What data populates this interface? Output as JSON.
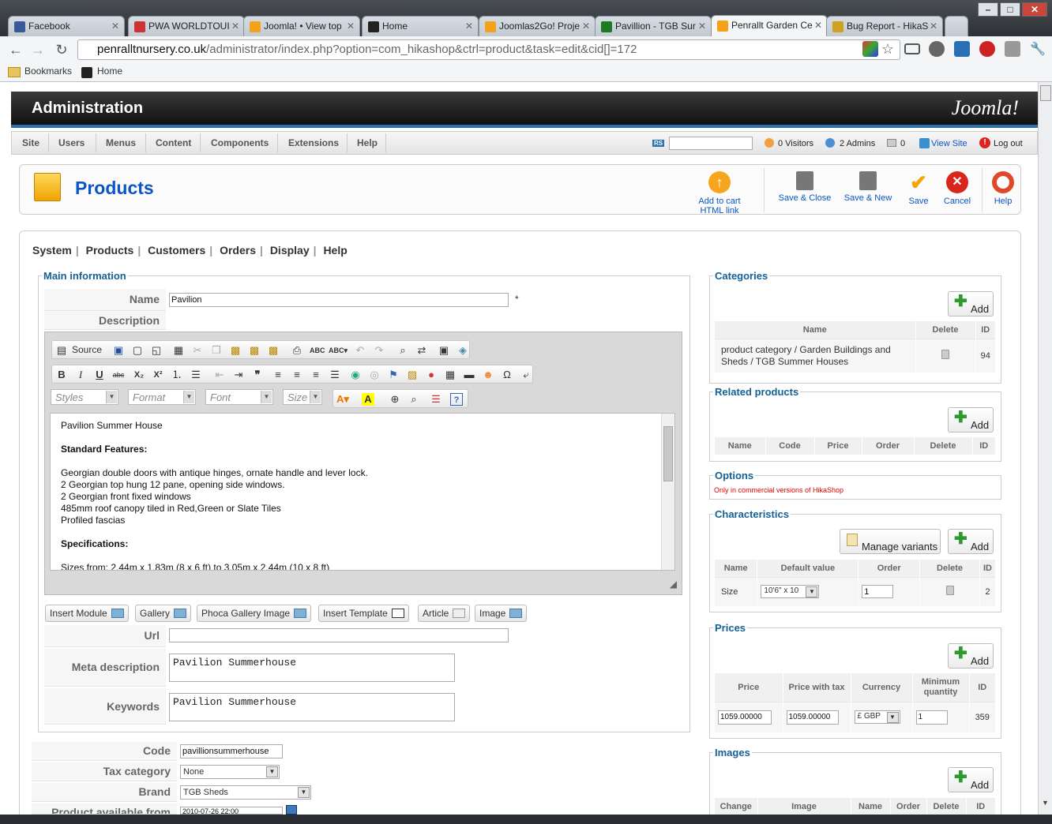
{
  "browser": {
    "tabs": [
      {
        "label": "Facebook",
        "color": "#3b5998"
      },
      {
        "label": "PWA WORLDTOUI",
        "color": "#cc3333"
      },
      {
        "label": "Joomla! • View top",
        "color": "#f4a21c"
      },
      {
        "label": "Home",
        "color": "#222222"
      },
      {
        "label": "Joomlas2Go! Proje",
        "color": "#f4a21c"
      },
      {
        "label": "Pavillion - TGB Sur",
        "color": "#1f7a1f"
      },
      {
        "label": "Penrallt Garden Ce",
        "color": "#f4a21c"
      },
      {
        "label": "Bug Report - HikaS",
        "color": "#d0a020"
      }
    ],
    "url_host": "penralltnursery.co.uk",
    "url_path": "/administrator/index.php?option=com_hikashop&ctrl=product&task=edit&cid[]=172",
    "bookmarks_label": "Bookmarks",
    "home_bookmark": "Home"
  },
  "admin": {
    "title": "Administration",
    "logo": "Joomla!",
    "menu": [
      "Site",
      "Users",
      "Menus",
      "Content",
      "Components",
      "Extensions",
      "Help"
    ],
    "visitors": "0 Visitors",
    "admins": "2 Admins",
    "messages": "0",
    "view_site": "View Site",
    "logout": "Log out",
    "rs_label": "RS"
  },
  "toolbar": {
    "page_title": "Products",
    "add_to_cart": "Add to cart HTML link",
    "save_close": "Save & Close",
    "save_new": "Save & New",
    "save": "Save",
    "cancel": "Cancel",
    "help": "Help"
  },
  "subnav": [
    "System",
    "Products",
    "Customers",
    "Orders",
    "Display",
    "Help"
  ],
  "main_info": {
    "legend": "Main information",
    "name_label": "Name",
    "name_value": "Pavilion",
    "required_mark": "*",
    "description_label": "Description",
    "url_label": "Url",
    "url_value": "",
    "meta_label": "Meta description",
    "meta_value": "Pavilion Summerhouse",
    "keywords_label": "Keywords",
    "keywords_value": "Pavilion Summerhouse"
  },
  "editor": {
    "source": "Source",
    "styles": "Styles",
    "format": "Format",
    "font": "Font",
    "size": "Size",
    "content": {
      "title": "Pavilion Summer House",
      "features_heading": "Standard Features:",
      "features": [
        "Georgian double doors with antique hinges, ornate handle and lever lock.",
        "2 Georgian top hung 12 pane, opening side windows.",
        "2 Georgian front fixed windows",
        "485mm roof canopy tiled in Red,Green or Slate Tiles",
        "Profiled fascias"
      ],
      "specs_heading": "Specifications:",
      "specs_line": "Sizes from: 2.44m x 1.83m (8 x 6 ft) to 3.05m x 2.44m (10 x 8 ft)"
    }
  },
  "editor_buttons": [
    "Insert Module",
    "Gallery",
    "Phoca Gallery Image",
    "Insert Template",
    "Article",
    "Image"
  ],
  "fields": {
    "code_label": "Code",
    "code_value": "pavillionsummerhouse",
    "tax_label": "Tax category",
    "tax_value": "None",
    "brand_label": "Brand",
    "brand_value": "TGB Sheds",
    "available_label": "Product available from",
    "available_value": "2010-07-26 22:00"
  },
  "categories": {
    "legend": "Categories",
    "add": "Add",
    "headers": [
      "Name",
      "Delete",
      "ID"
    ],
    "row": {
      "name_part1": "product category / ",
      "name_part2": "Garden Buildings and Sheds / TGB Summer Houses",
      "id": "94"
    }
  },
  "related": {
    "legend": "Related products",
    "add": "Add",
    "headers": [
      "Name",
      "Code",
      "Price",
      "Order",
      "Delete",
      "ID"
    ]
  },
  "options": {
    "legend": "Options",
    "note": "Only in commercial versions of HikaShop"
  },
  "characteristics": {
    "legend": "Characteristics",
    "manage": "Manage variants",
    "add": "Add",
    "headers": [
      "Name",
      "Default value",
      "Order",
      "Delete",
      "ID"
    ],
    "row": {
      "name": "Size",
      "default": "10'6\" x 10",
      "order": "1",
      "id": "2"
    }
  },
  "prices": {
    "legend": "Prices",
    "add": "Add",
    "headers": [
      "Price",
      "Price with tax",
      "Currency",
      "Minimum quantity",
      "ID"
    ],
    "row": {
      "price": "1059.00000",
      "price_tax": "1059.00000",
      "currency": "£ GBP",
      "min_qty": "1",
      "id": "359"
    }
  },
  "images": {
    "legend": "Images",
    "add": "Add",
    "headers": [
      "Change",
      "Image",
      "Name",
      "Order",
      "Delete",
      "ID"
    ]
  }
}
